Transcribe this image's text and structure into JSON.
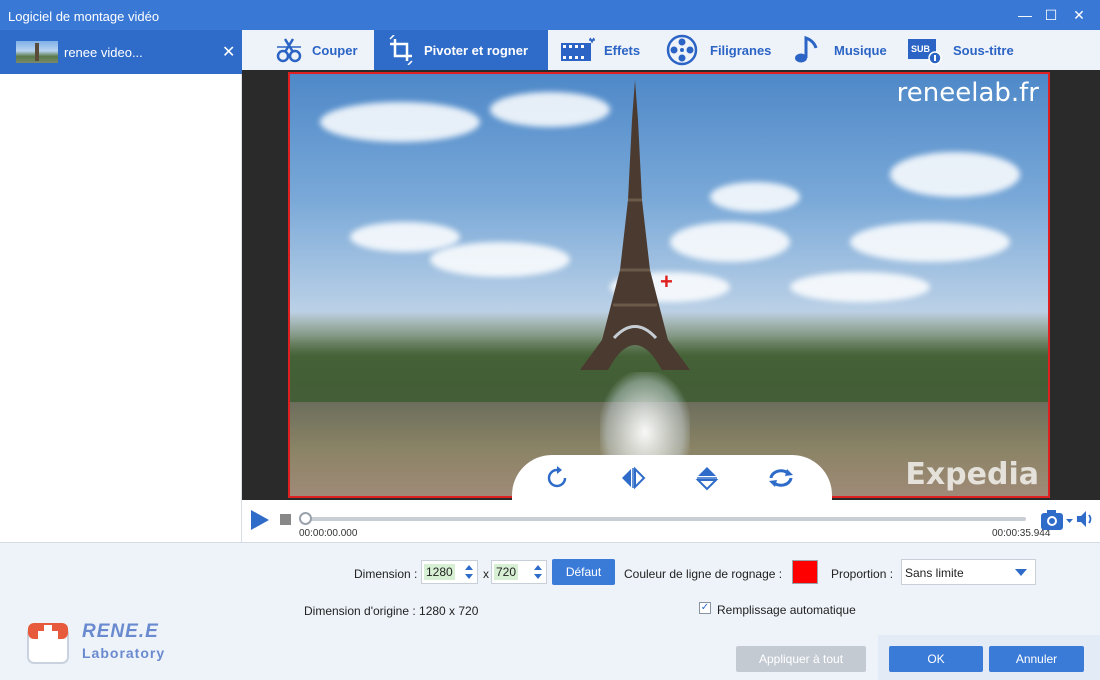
{
  "window": {
    "title": "Logiciel de montage vidéo",
    "controls": {
      "minimize": "—",
      "maximize": "☐",
      "close": "✕"
    }
  },
  "file_tab": {
    "name": "renee video...",
    "close": "✕"
  },
  "toolbar": {
    "items": [
      {
        "label": "Couper",
        "icon": "cut-icon"
      },
      {
        "label": "Pivoter et rogner",
        "icon": "crop-rotate-icon",
        "active": true
      },
      {
        "label": "Effets",
        "icon": "effects-icon"
      },
      {
        "label": "Filigranes",
        "icon": "watermark-icon"
      },
      {
        "label": "Musique",
        "icon": "music-icon"
      },
      {
        "label": "Sous-titre",
        "icon": "subtitle-icon"
      }
    ]
  },
  "preview": {
    "watermark_top": "reneelab.fr",
    "watermark_bottom": "Expedia",
    "crop_color": "#e02020"
  },
  "rotate_tools": [
    "rotate-clockwise-icon",
    "flip-horizontal-icon",
    "flip-vertical-icon",
    "rotate-reset-icon"
  ],
  "playback": {
    "current_time": "00:00:00.000",
    "total_time": "00:00:35.944",
    "progress": 0
  },
  "settings": {
    "dimension_label": "Dimension :",
    "width": "1280",
    "separator": "x",
    "height": "720",
    "default_button": "Défaut",
    "crop_color_label": "Couleur de ligne de rognage :",
    "crop_color": "#ff0000",
    "proportion_label": "Proportion :",
    "proportion_value": "Sans limite",
    "original_dimension": "Dimension d'origine : 1280 x 720",
    "auto_fill_label": "Remplissage automatique",
    "auto_fill_checked": true
  },
  "brand": {
    "name": "RENE.E",
    "sub": "Laboratory"
  },
  "actions": {
    "apply_all": "Appliquer à tout",
    "ok": "OK",
    "cancel": "Annuler"
  }
}
